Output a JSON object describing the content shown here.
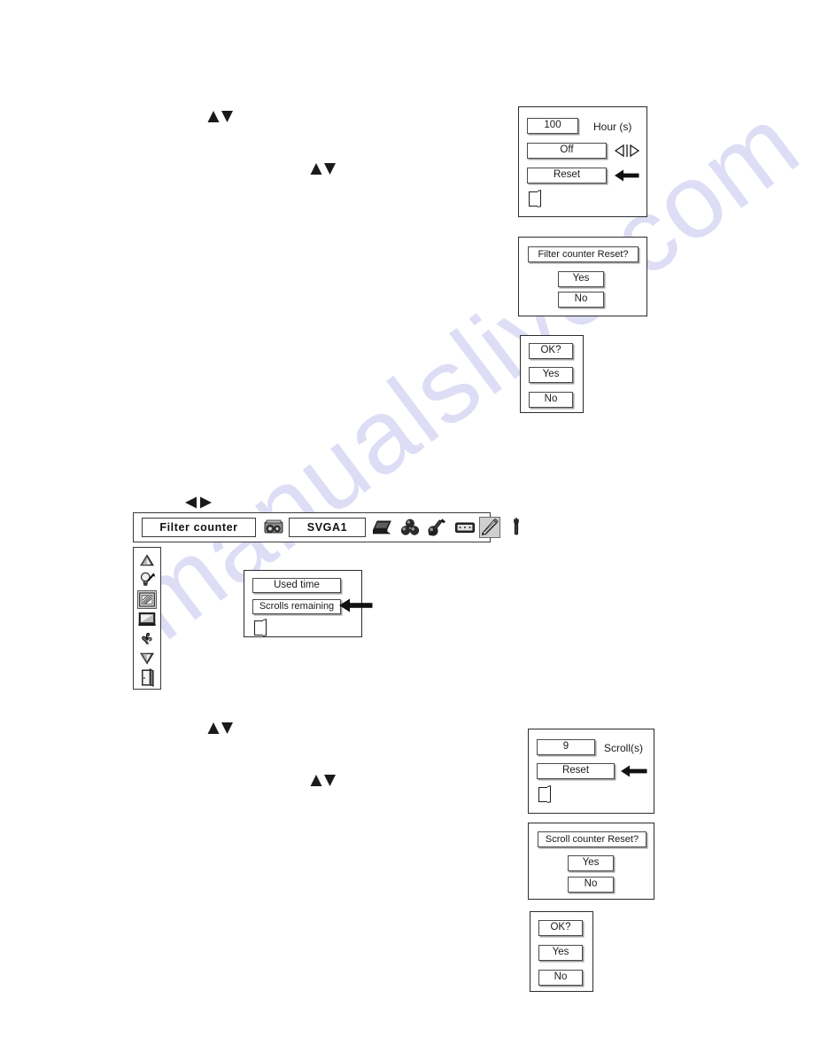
{
  "watermark": {
    "text": "manualslive.com"
  },
  "panels": {
    "filter_counter_settings": {
      "name": "Filter counter settings",
      "hours_value": "100",
      "hours_label": "Hour (s)",
      "timer_value": "Off",
      "reset_label": "Reset",
      "quit_icon": "door-exit-icon",
      "adjust_icon": "left-right-arrow-icon",
      "pointer_icon": "left-arrow-pointer-icon"
    },
    "filter_counter_reset_confirm": {
      "name": "Filter counter Reset confirm",
      "title": "Filter counter Reset?",
      "yes_label": "Yes",
      "no_label": "No"
    },
    "filter_ok_confirm": {
      "name": "Filter OK confirm",
      "title": "OK?",
      "yes_label": "Yes",
      "no_label": "No"
    },
    "scroll_counter_settings": {
      "name": "Scroll counter settings",
      "scrolls_value": "9",
      "scrolls_label": "Scroll(s)",
      "reset_label": "Reset",
      "quit_icon": "door-exit-icon",
      "pointer_icon": "left-arrow-pointer-icon"
    },
    "scroll_counter_reset_confirm": {
      "name": "Scroll counter Reset confirm",
      "title": "Scroll counter Reset?",
      "yes_label": "Yes",
      "no_label": "No"
    },
    "scroll_ok_confirm": {
      "name": "Scroll OK confirm",
      "title": "OK?",
      "yes_label": "Yes",
      "no_label": "No"
    },
    "filter_counter_submenu": {
      "name": "Filter counter submenu",
      "used_time_label": "Used time",
      "scrolls_remaining_label": "Scrolls remaining",
      "quit_icon": "door-exit-icon",
      "pointer_icon": "left-arrow-pointer-icon"
    }
  },
  "menu_bar": {
    "title": "Filter  counter",
    "source": "SVGA1",
    "source_icon": "input-source-icon",
    "icons": [
      {
        "name": "computer-icon",
        "selected": false
      },
      {
        "name": "color-adjust-icon",
        "selected": false
      },
      {
        "name": "paint-brush-icon",
        "selected": false
      },
      {
        "name": "screen-icon",
        "selected": false
      },
      {
        "name": "setting-pencil-icon",
        "selected": true
      },
      {
        "name": "service-tool-icon",
        "selected": false
      }
    ]
  },
  "icon_strip": {
    "items": [
      {
        "name": "scroll-up-arrow-icon",
        "selected": false
      },
      {
        "name": "lamp-control-icon",
        "selected": false
      },
      {
        "name": "filter-counter-icon",
        "selected": true
      },
      {
        "name": "screen-display-icon",
        "selected": false
      },
      {
        "name": "fan-control-icon",
        "selected": false
      },
      {
        "name": "scroll-down-arrow-icon",
        "selected": false
      },
      {
        "name": "quit-door-icon",
        "selected": false
      }
    ]
  },
  "glyphs": {
    "up_down_1": "up-down-triangle-glyph",
    "up_down_2": "up-down-triangle-glyph",
    "left_right_1": "left-right-triangle-glyph",
    "up_down_3": "up-down-triangle-glyph",
    "up_down_4": "up-down-triangle-glyph"
  }
}
